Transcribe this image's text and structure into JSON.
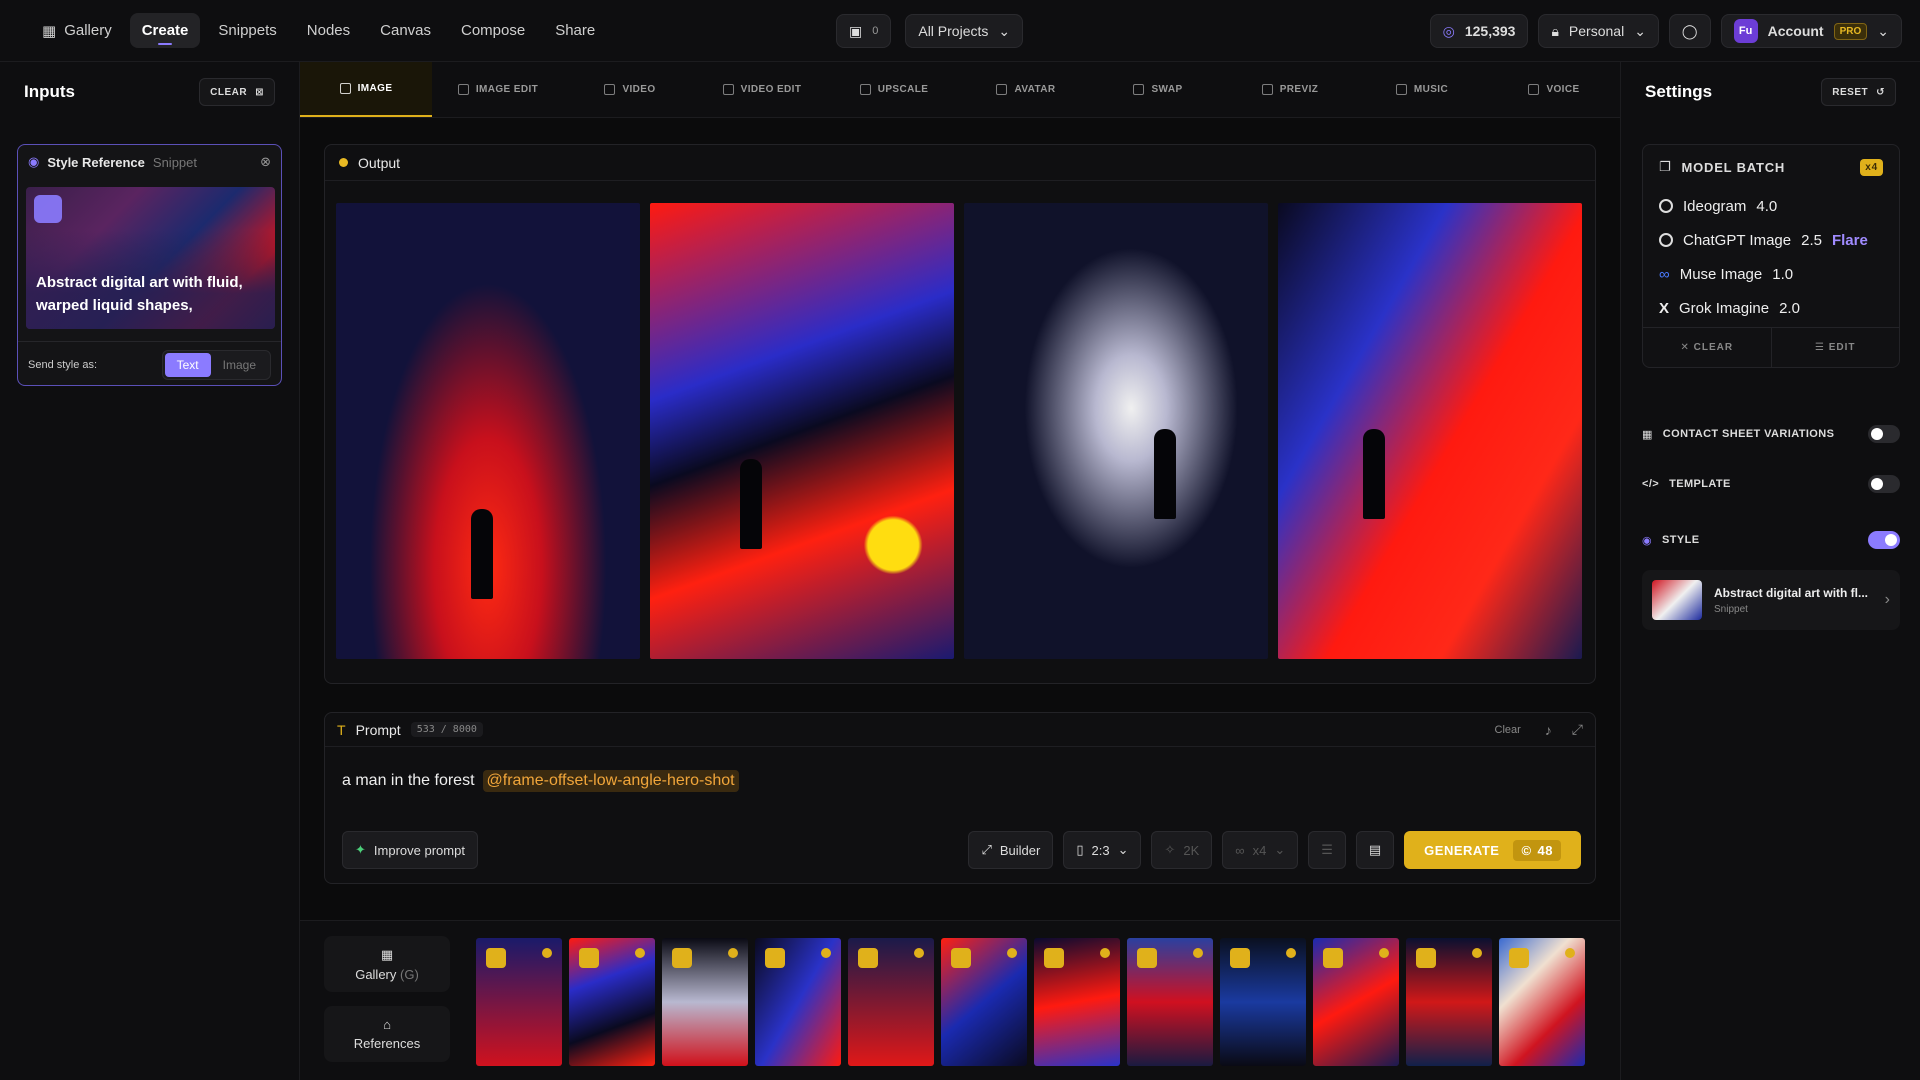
{
  "topbar": {
    "nav": [
      "Gallery",
      "Create",
      "Snippets",
      "Nodes",
      "Canvas",
      "Compose",
      "Share"
    ],
    "queue_count": "0",
    "projects": "All Projects",
    "credits": "125,393",
    "workspace": "Personal",
    "account": "Account",
    "account_initials": "Fu",
    "pro": "PRO"
  },
  "inputs": {
    "title": "Inputs",
    "clear": "CLEAR",
    "snippet_title": "Style Reference",
    "snippet_kind": "Snippet",
    "snippet_text": "Abstract digital art with fluid, warped liquid shapes,",
    "send_as": "Send style as:",
    "seg_text": "Text",
    "seg_image": "Image"
  },
  "tabs": [
    "IMAGE",
    "IMAGE EDIT",
    "VIDEO",
    "VIDEO EDIT",
    "UPSCALE",
    "AVATAR",
    "SWAP",
    "PREVIZ",
    "MUSIC",
    "VOICE"
  ],
  "output": {
    "title": "Output"
  },
  "prompt": {
    "title": "Prompt",
    "count": "533 / 8000",
    "clear": "Clear",
    "text": "a man in the forest",
    "mention": "@frame-offset-low-angle-hero-shot",
    "improve": "Improve prompt",
    "builder": "Builder",
    "ratio": "2:3",
    "res": "2K",
    "batch": "x4",
    "generate": "GENERATE",
    "cost": "48"
  },
  "bottom": {
    "gallery": "Gallery",
    "gallery_key": "(G)",
    "references": "References"
  },
  "settings": {
    "title": "Settings",
    "reset": "RESET",
    "batch_title": "MODEL BATCH",
    "batch_badge": "x4",
    "models": [
      {
        "name": "Ideogram",
        "version": "4.0",
        "tag": ""
      },
      {
        "name": "ChatGPT Image",
        "version": "2.5",
        "tag": "Flare"
      },
      {
        "name": "Muse Image",
        "version": "1.0",
        "tag": ""
      },
      {
        "name": "Grok Imagine",
        "version": "2.0",
        "tag": ""
      }
    ],
    "clear": "CLEAR",
    "edit": "EDIT",
    "contact_sheet": "CONTACT SHEET VARIATIONS",
    "template": "TEMPLATE",
    "style": "STYLE",
    "style_card_title": "Abstract digital art with fl...",
    "style_card_sub": "Snippet"
  },
  "colors": {
    "accent": "#e0b11b",
    "purple": "#8b7bff"
  }
}
